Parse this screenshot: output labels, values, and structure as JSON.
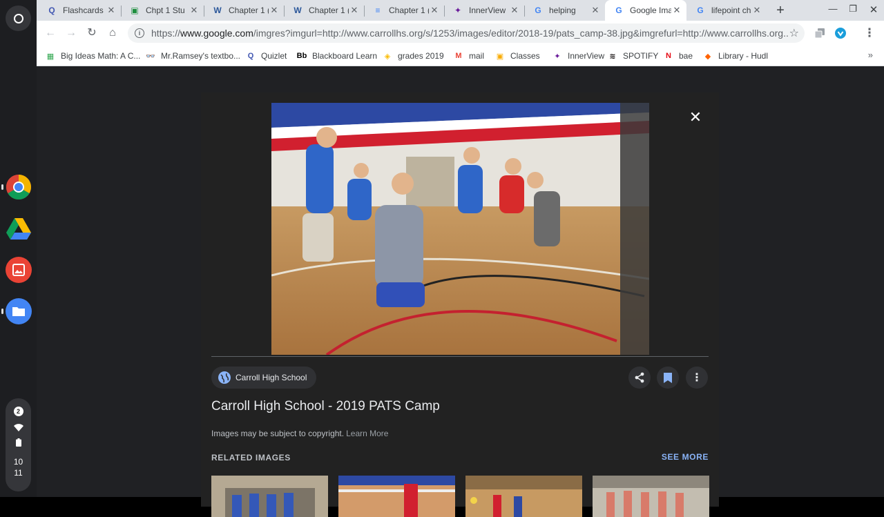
{
  "shelf": {
    "notification_count": "2",
    "clock_hour": "10",
    "clock_minute": "11"
  },
  "tabs": [
    {
      "label": "Flashcards",
      "icon": "quizlet-icon",
      "color": "#4257b2",
      "glyph": "Q"
    },
    {
      "label": "Chpt 1 Stu",
      "icon": "classroom-icon",
      "color": "#1e8e3e",
      "glyph": "▣"
    },
    {
      "label": "Chapter 1 (",
      "icon": "word-icon",
      "color": "#2b579a",
      "glyph": "W"
    },
    {
      "label": "Chapter 1 (",
      "icon": "word-icon",
      "color": "#2b579a",
      "glyph": "W"
    },
    {
      "label": "Chapter 1 (",
      "icon": "docs-icon",
      "color": "#4285f4",
      "glyph": "≡"
    },
    {
      "label": "InnerView",
      "icon": "innerview-icon",
      "color": "#6a1b9a",
      "glyph": "✦"
    },
    {
      "label": "helping",
      "icon": "google-icon",
      "color": "#4285f4",
      "glyph": "G"
    },
    {
      "label": "Google Ima",
      "icon": "google-icon",
      "color": "#4285f4",
      "glyph": "G"
    },
    {
      "label": "lifepoint ch",
      "icon": "google-icon",
      "color": "#4285f4",
      "glyph": "G"
    }
  ],
  "active_tab_index": 7,
  "url": {
    "scheme": "https://",
    "host": "www.google.com",
    "path": "/imgres?imgurl=http://www.carrollhs.org/s/1253/images/editor/2018-19/pats_camp-38.jpg&imgrefurl=http://www.carrollhs.org..."
  },
  "bookmarks": [
    {
      "label": "Big Ideas Math: A C...",
      "icon": "bigideas-icon",
      "color": "#34a853",
      "glyph": "▦"
    },
    {
      "label": "Mr.Ramsey's textbo...",
      "icon": "glasses-icon",
      "color": "#202124",
      "glyph": "👓"
    },
    {
      "label": "Quizlet",
      "icon": "quizlet-icon",
      "color": "#4257b2",
      "glyph": "Q"
    },
    {
      "label": "Blackboard Learn",
      "icon": "blackboard-icon",
      "color": "#000000",
      "glyph": "Bb"
    },
    {
      "label": "grades 2019",
      "icon": "layers-icon",
      "color": "#fbbc04",
      "glyph": "◈"
    },
    {
      "label": "mail",
      "icon": "gmail-icon",
      "color": "#ea4335",
      "glyph": "M"
    },
    {
      "label": "Classes",
      "icon": "classroom-icon",
      "color": "#f9ab00",
      "glyph": "▣"
    },
    {
      "label": "InnerView",
      "icon": "innerview-icon",
      "color": "#6a1b9a",
      "glyph": "✦"
    },
    {
      "label": "SPOTIFY",
      "icon": "spotify-icon",
      "color": "#191414",
      "glyph": "≋"
    },
    {
      "label": "bae",
      "icon": "netflix-icon",
      "color": "#e50914",
      "glyph": "N"
    },
    {
      "label": "Library - Hudl",
      "icon": "hudl-icon",
      "color": "#ff6300",
      "glyph": "◆"
    }
  ],
  "viewer": {
    "source": "Carroll High School",
    "title": "Carroll High School - 2019 PATS Camp",
    "copyright": "Images may be subject to copyright.",
    "learn_more": "Learn More",
    "related_heading": "RELATED IMAGES",
    "see_more": "SEE MORE"
  },
  "colors": {
    "viewer_bg": "#222222",
    "link_blue": "#8ab4f8",
    "gym_red": "#d1202f",
    "gym_blue": "#2d49a3"
  }
}
